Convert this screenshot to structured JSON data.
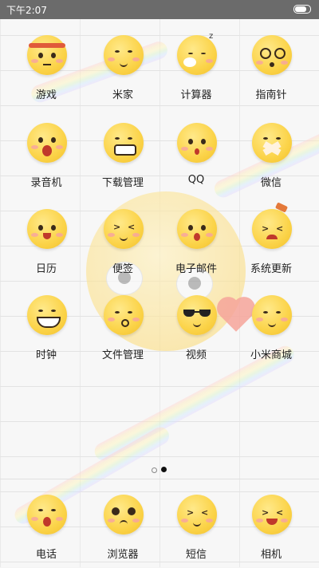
{
  "status_bar": {
    "time": "下午2:07"
  },
  "grid": {
    "rows": [
      [
        {
          "label": "游戏",
          "icon": "headband-face-icon"
        },
        {
          "label": "米家",
          "icon": "cheeky-face-icon"
        },
        {
          "label": "计算器",
          "icon": "sleepy-face-icon"
        },
        {
          "label": "指南针",
          "icon": "dizzy-face-icon"
        }
      ],
      [
        {
          "label": "录音机",
          "icon": "shouting-face-icon"
        },
        {
          "label": "下载管理",
          "icon": "grinning-face-icon"
        },
        {
          "label": "QQ",
          "icon": "surprised-face-icon"
        },
        {
          "label": "微信",
          "icon": "bandaged-face-icon"
        }
      ],
      [
        {
          "label": "日历",
          "icon": "cheer-face-icon"
        },
        {
          "label": "便签",
          "icon": "squint-face-icon"
        },
        {
          "label": "电子邮件",
          "icon": "shocked-face-icon"
        },
        {
          "label": "系统更新",
          "icon": "hammer-face-icon"
        }
      ],
      [
        {
          "label": "时钟",
          "icon": "toothy-face-icon"
        },
        {
          "label": "文件管理",
          "icon": "kiss-face-icon"
        },
        {
          "label": "视频",
          "icon": "sunglasses-face-icon"
        },
        {
          "label": "小米商城",
          "icon": "smile-face-icon"
        }
      ]
    ]
  },
  "page_indicator": {
    "pages": 2,
    "active": 2
  },
  "dock": [
    {
      "label": "电话",
      "icon": "yawn-face-icon"
    },
    {
      "label": "浏览器",
      "icon": "teary-face-icon"
    },
    {
      "label": "短信",
      "icon": "wink-face-icon"
    },
    {
      "label": "相机",
      "icon": "laughing-face-icon"
    }
  ]
}
